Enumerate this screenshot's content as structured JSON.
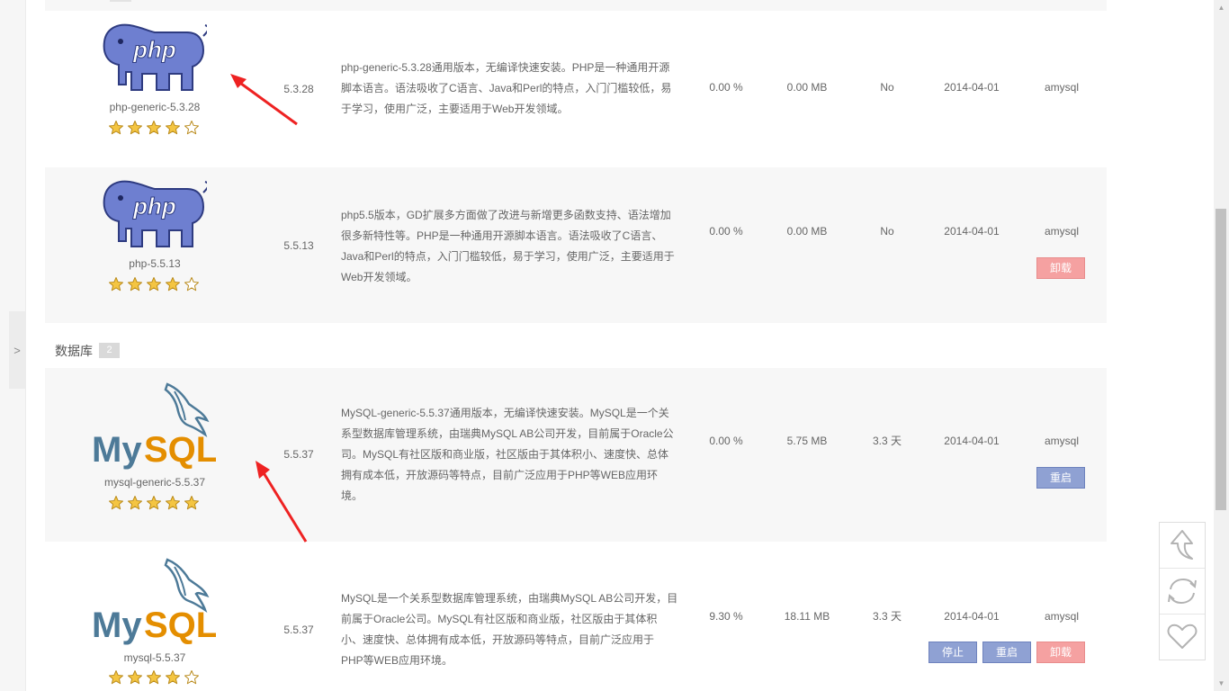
{
  "sidebar": {
    "toggle_label": ">"
  },
  "sections": [
    {
      "title": "数据库",
      "count": "2"
    }
  ],
  "packages": [
    {
      "logo": "php-elephant-logo",
      "name": "php-generic-5.3.28",
      "stars": 4,
      "version": "5.3.28",
      "description": "php-generic-5.3.28通用版本，无编译快速安装。PHP是一种通用开源脚本语言。语法吸收了C语言、Java和Perl的特点，入门门槛较低，易于学习，使用广泛，主要适用于Web开发领域。",
      "desc_lines": [
        "php-generic-5.3.28通用版本，无编译快速安装。PHP是一种通用开源",
        "脚本语言。语法吸收了C语言、Java和Perl的特点，入门门槛较低，易",
        "于学习，使用广泛，主要适用于Web开发领域。"
      ],
      "cpu": "0.00 %",
      "memory": "0.00 MB",
      "status": "No",
      "date": "2014-04-01",
      "user": "amysql",
      "buttons": []
    },
    {
      "logo": "php-elephant-logo",
      "name": "php-5.5.13",
      "stars": 4,
      "version": "5.5.13",
      "description": "php5.5版本，GD扩展多方面做了改进与新增更多函数支持、语法增加很多新特性等。PHP是一种通用开源脚本语言。语法吸收了C语言、Java和Perl的特点，入门门槛较低，易于学习，使用广泛，主要适用于Web开发领域。",
      "desc_lines": [
        "php5.5版本，GD扩展多方面做了改进与新增更多函数支持、语法增加",
        "很多新特性等。PHP是一种通用开源脚本语言。语法吸收了C语言、",
        "Java和Perl的特点，入门门槛较低，易于学习，使用广泛，主要适用于",
        "Web开发领域。"
      ],
      "cpu": "0.00 %",
      "memory": "0.00 MB",
      "status": "No",
      "date": "2014-04-01",
      "user": "amysql",
      "buttons": [
        {
          "label": "卸载",
          "color": "#f5a1a1"
        }
      ]
    },
    {
      "logo": "mysql-dolphin-logo",
      "name": "mysql-generic-5.5.37",
      "stars": 5,
      "version": "5.5.37",
      "description": "MySQL-generic-5.5.37通用版本，无编译快速安装。MySQL是一个关系型数据库管理系统，由瑞典MySQL AB公司开发，目前属于Oracle公司。MySQL有社区版和商业版，社区版由于其体积小、速度快、总体拥有成本低，开放源码等特点，目前广泛应用于PHP等WEB应用环境。",
      "desc_lines": [
        "MySQL-generic-5.5.37通用版本，无编译快速安装。MySQL是一个关",
        "系型数据库管理系统，由瑞典MySQL AB公司开发，目前属于Oracle公",
        "司。MySQL有社区版和商业版，社区版由于其体积小、速度快、总体",
        "拥有成本低，开放源码等特点，目前广泛应用于PHP等WEB应用环",
        "境。"
      ],
      "cpu": "0.00 %",
      "memory": "5.75 MB",
      "status": "3.3 天",
      "date": "2014-04-01",
      "user": "amysql",
      "buttons": [
        {
          "label": "重启",
          "color": "#8fa1d3"
        }
      ]
    },
    {
      "logo": "mysql-dolphin-logo",
      "name": "mysql-5.5.37",
      "stars": 4,
      "version": "5.5.37",
      "description": "MySQL是一个关系型数据库管理系统，由瑞典MySQL AB公司开发，目前属于Oracle公司。MySQL有社区版和商业版，社区版由于其体积小、速度快、总体拥有成本低，开放源码等特点，目前广泛应用于PHP等WEB应用环境。",
      "desc_lines": [
        "MySQL是一个关系型数据库管理系统，由瑞典MySQL AB公司开发，目",
        "前属于Oracle公司。MySQL有社区版和商业版，社区版由于其体积",
        "小、速度快、总体拥有成本低，开放源码等特点，目前广泛应用于",
        "PHP等WEB应用环境。"
      ],
      "cpu": "9.30 %",
      "memory": "18.11 MB",
      "status": "3.3 天",
      "date": "2014-04-01",
      "user": "amysql",
      "buttons": [
        {
          "label": "停止",
          "color": "#8fa1d3"
        },
        {
          "label": "重启",
          "color": "#8fa1d3"
        },
        {
          "label": "卸载",
          "color": "#f5a1a1"
        }
      ]
    }
  ],
  "logo_text": {
    "php": "php",
    "mysql_my": "My",
    "mysql_sql": "SQL"
  },
  "float_tools": [
    {
      "icon": "back-to-top-icon"
    },
    {
      "icon": "refresh-icon"
    },
    {
      "icon": "favorite-heart-icon"
    }
  ],
  "colors": {
    "row_bg": "#f7f7f7",
    "uninstall_button": "#f5a1a1",
    "action_button": "#8fa1d3",
    "annotation_arrow": "#ee2222",
    "php_logo": "#6e7fd0",
    "mysql_blue": "#4d7a98",
    "mysql_orange": "#e48e00",
    "star_gold": "#f4c542"
  }
}
